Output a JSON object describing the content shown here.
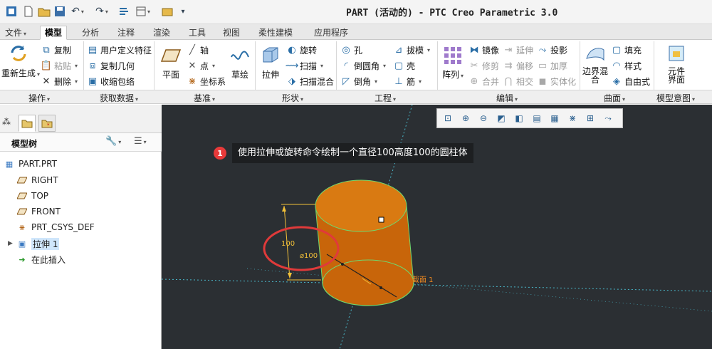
{
  "window": {
    "title": "PART (活动的) - PTC Creo Parametric 3.0"
  },
  "tabs": [
    "文件",
    "模型",
    "分析",
    "注释",
    "渲染",
    "工具",
    "视图",
    "柔性建模",
    "应用程序"
  ],
  "active_tab": "模型",
  "ribbon": {
    "ops": {
      "regen": "重新生成",
      "copy": "复制",
      "paste": "粘贴",
      "delete": "删除"
    },
    "data": {
      "udf": "用户定义特征",
      "copy_geom": "复制几何",
      "shrinkwrap": "收缩包络"
    },
    "datum": {
      "plane": "平面",
      "axis": "轴",
      "point": "点",
      "csys": "坐标系",
      "sketch": "草绘"
    },
    "shapes": {
      "extrude": "拉伸",
      "revolve": "旋转",
      "sweep": "扫描",
      "swept_blend": "扫描混合"
    },
    "eng": {
      "hole": "孔",
      "round": "倒圆角",
      "chamfer": "倒角",
      "draft": "拔模",
      "shell": "壳",
      "rib": "筋"
    },
    "edit": {
      "pattern": "阵列",
      "mirror": "镜像",
      "trim": "修剪",
      "merge": "合并",
      "extend": "延伸",
      "offset": "偏移",
      "intersect": "相交",
      "project": "投影",
      "thicken": "加厚",
      "solidify": "实体化"
    },
    "surfaces": {
      "boundary_blend": "边界混合",
      "fill": "填充",
      "style": "样式",
      "freestyle": "自由式"
    },
    "intent": {
      "component_interface": "元件界面"
    },
    "groups": [
      "操作",
      "获取数据",
      "基准",
      "形状",
      "工程",
      "编辑",
      "曲面",
      "模型意图"
    ]
  },
  "model_tree": {
    "title": "模型树",
    "items": [
      {
        "label": "PART.PRT",
        "icon": "part-icon"
      },
      {
        "label": "RIGHT",
        "icon": "datum-plane-icon"
      },
      {
        "label": "TOP",
        "icon": "datum-plane-icon"
      },
      {
        "label": "FRONT",
        "icon": "datum-plane-icon"
      },
      {
        "label": "PRT_CSYS_DEF",
        "icon": "csys-icon"
      },
      {
        "label": "拉伸 1",
        "icon": "extrude-feature-icon"
      },
      {
        "label": "在此插入",
        "icon": "insert-arrow-icon"
      }
    ]
  },
  "callout": {
    "number": "1",
    "text": "使用拉伸或旋转命令绘制一个直径100高度100的圆柱体"
  },
  "model": {
    "height_dim": "100",
    "diameter_dim": "⌀100",
    "section_label": "截面 1"
  },
  "colors": {
    "viewport_bg": "#2b2f33",
    "cylinder": "#c8650a",
    "cylinder_top": "#d97a12",
    "dimension": "#f2c038",
    "highlight": "#e03a3a",
    "edge": "#5fd35f"
  }
}
